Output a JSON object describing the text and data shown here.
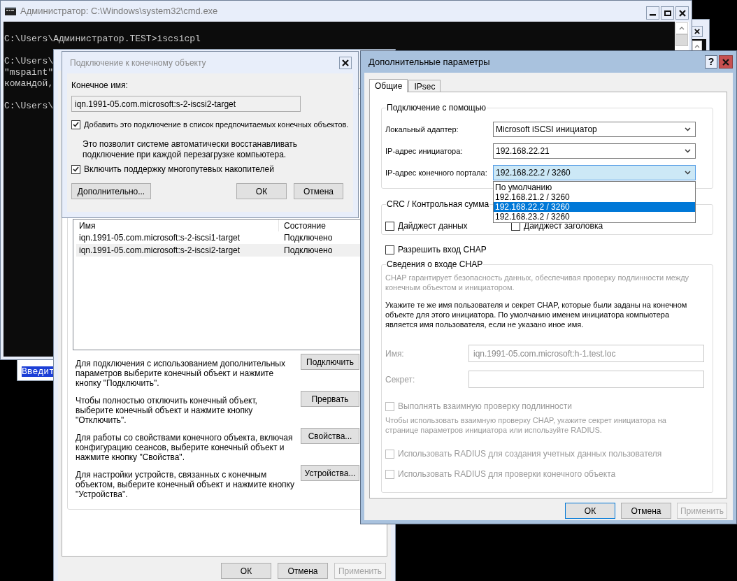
{
  "background_window": {
    "selected_text": "Введит"
  },
  "console_window": {
    "title": "Администратор: C:\\Windows\\system32\\cmd.exe",
    "blocks": [
      [
        "C:\\Users\\Администратор.TEST>iscsicpl"
      ],
      [
        "C:\\Users\\",
        "\"mspaint\"",
        "командой,"
      ],
      [
        "C:\\Users\\"
      ]
    ]
  },
  "initiator_window": {
    "targets": {
      "columns": [
        "Имя",
        "Состояние"
      ],
      "rows": [
        {
          "name": "iqn.1991-05.com.microsoft:s-2-iscsi1-target",
          "status": "Подключено",
          "selected": false
        },
        {
          "name": "iqn.1991-05.com.microsoft:s-2-iscsi2-target",
          "status": "Подключено",
          "selected": true
        }
      ]
    },
    "actions": [
      {
        "description": "Для подключения с использованием дополнительных\nпараметров выберите конечный объект и нажмите\nкнопку \"Подключить\".",
        "button": "Подключить"
      },
      {
        "description": "Чтобы полностью отключить конечный объект,\nвыберите конечный объект и нажмите кнопку\n\"Отключить\".",
        "button": "Прервать"
      },
      {
        "description": "Для работы со свойствами конечного объекта, включая\nконфигурацию сеансов, выберите конечный объект и\nнажмите кнопку \"Свойства\".",
        "button": "Свойства..."
      },
      {
        "description": "Для настройки устройств, связанных с конечным\nобъектом, выберите конечный объект и нажмите кнопку\n\"Устройства\".",
        "button": "Устройства..."
      }
    ],
    "buttons": [
      {
        "label": "ОК",
        "disabled": false
      },
      {
        "label": "Отмена",
        "disabled": false
      },
      {
        "label": "Применить",
        "disabled": true
      }
    ]
  },
  "connect_dialog": {
    "title": "Подключение к конечному объекту",
    "target_label": "Конечное имя:",
    "target_value": "iqn.1991-05.com.microsoft:s-2-iscsi2-target",
    "favorite": {
      "label": "Добавить это подключение в список предпочитаемых конечных объектов.",
      "checked": true
    },
    "note": "Это позволит системе автоматически восстанавливать\nподключение при каждой перезагрузке компьютера.",
    "multipath": {
      "label": "Включить поддержку многопутевых накопителей",
      "checked": true
    },
    "buttons": [
      {
        "label": "Дополнительно..."
      },
      {
        "label": "ОК"
      },
      {
        "label": "Отмена"
      }
    ]
  },
  "advanced_dialog": {
    "title": "Дополнительные параметры",
    "help_button": "?",
    "tabs": [
      {
        "label": "Общие",
        "selected": true
      },
      {
        "label": "IPsec",
        "selected": false
      }
    ],
    "connect_group": {
      "legend": "Подключение с помощью",
      "fields": [
        {
          "label": "Локальный адаптер:",
          "value": "Microsoft iSCSI инициатор",
          "focused": false
        },
        {
          "label": "IP-адрес инициатора:",
          "value": "192.168.22.21",
          "focused": false
        },
        {
          "label": "IP-адрес конечного портала:",
          "value": "192.168.22.2 / 3260",
          "focused": true
        }
      ]
    },
    "dropdown_options": [
      {
        "label": "По умолчанию",
        "selected": false
      },
      {
        "label": "192.168.21.2 / 3260",
        "selected": false
      },
      {
        "label": "192.168.22.2 / 3260",
        "selected": true
      },
      {
        "label": "192.168.23.2 / 3260",
        "selected": false
      }
    ],
    "crc_group": {
      "legend": "CRC / Контрольная сумма",
      "checkboxes": [
        {
          "label": "Дайджест данных",
          "checked": false
        },
        {
          "label": "Дайджест заголовка",
          "checked": false
        }
      ]
    },
    "chap_checkbox": {
      "label": "Разрешить вход CHAP",
      "checked": false
    },
    "chap_group": {
      "legend": "Сведения о входе CHAP",
      "items": [
        {
          "kind": "note",
          "text": "CHAP гарантирует безопасность данных, обеспечивая проверку подлинности между\nконечным объектом и инициатором.",
          "disabled": true
        },
        {
          "kind": "note",
          "text": "Укажите те же имя пользователя и секрет CHAP, которые были заданы на конечном\nобъекте для этого инициатора. По умолчанию именем инициатора компьютера\nявляется имя пользователя, если не указано иное имя.",
          "disabled": false
        },
        {
          "kind": "field",
          "label": "Имя:",
          "value": "iqn.1991-05.com.microsoft:h-1.test.loc",
          "disabled": true
        },
        {
          "kind": "field",
          "label": "Секрет:",
          "disabled": true
        },
        {
          "kind": "checkbox",
          "label": "Выполнять взаимную проверку подлинности",
          "checked": false,
          "disabled": true
        },
        {
          "kind": "note",
          "text": "Чтобы использовать взаимную проверку CHAP, укажите секрет инициатора на\nстранице параметров инициатора или используйте RADIUS.",
          "disabled": true
        },
        {
          "kind": "checkbox",
          "label": "Использовать RADIUS для создания учетных данных пользователя",
          "checked": false,
          "disabled": true
        },
        {
          "kind": "checkbox",
          "label": "Использовать RADIUS для проверки конечного объекта",
          "checked": false,
          "disabled": true
        }
      ]
    },
    "buttons": [
      {
        "label": "ОК",
        "default": true,
        "disabled": false
      },
      {
        "label": "Отмена",
        "default": false,
        "disabled": false
      },
      {
        "label": "Применить",
        "default": false,
        "disabled": true
      }
    ]
  }
}
